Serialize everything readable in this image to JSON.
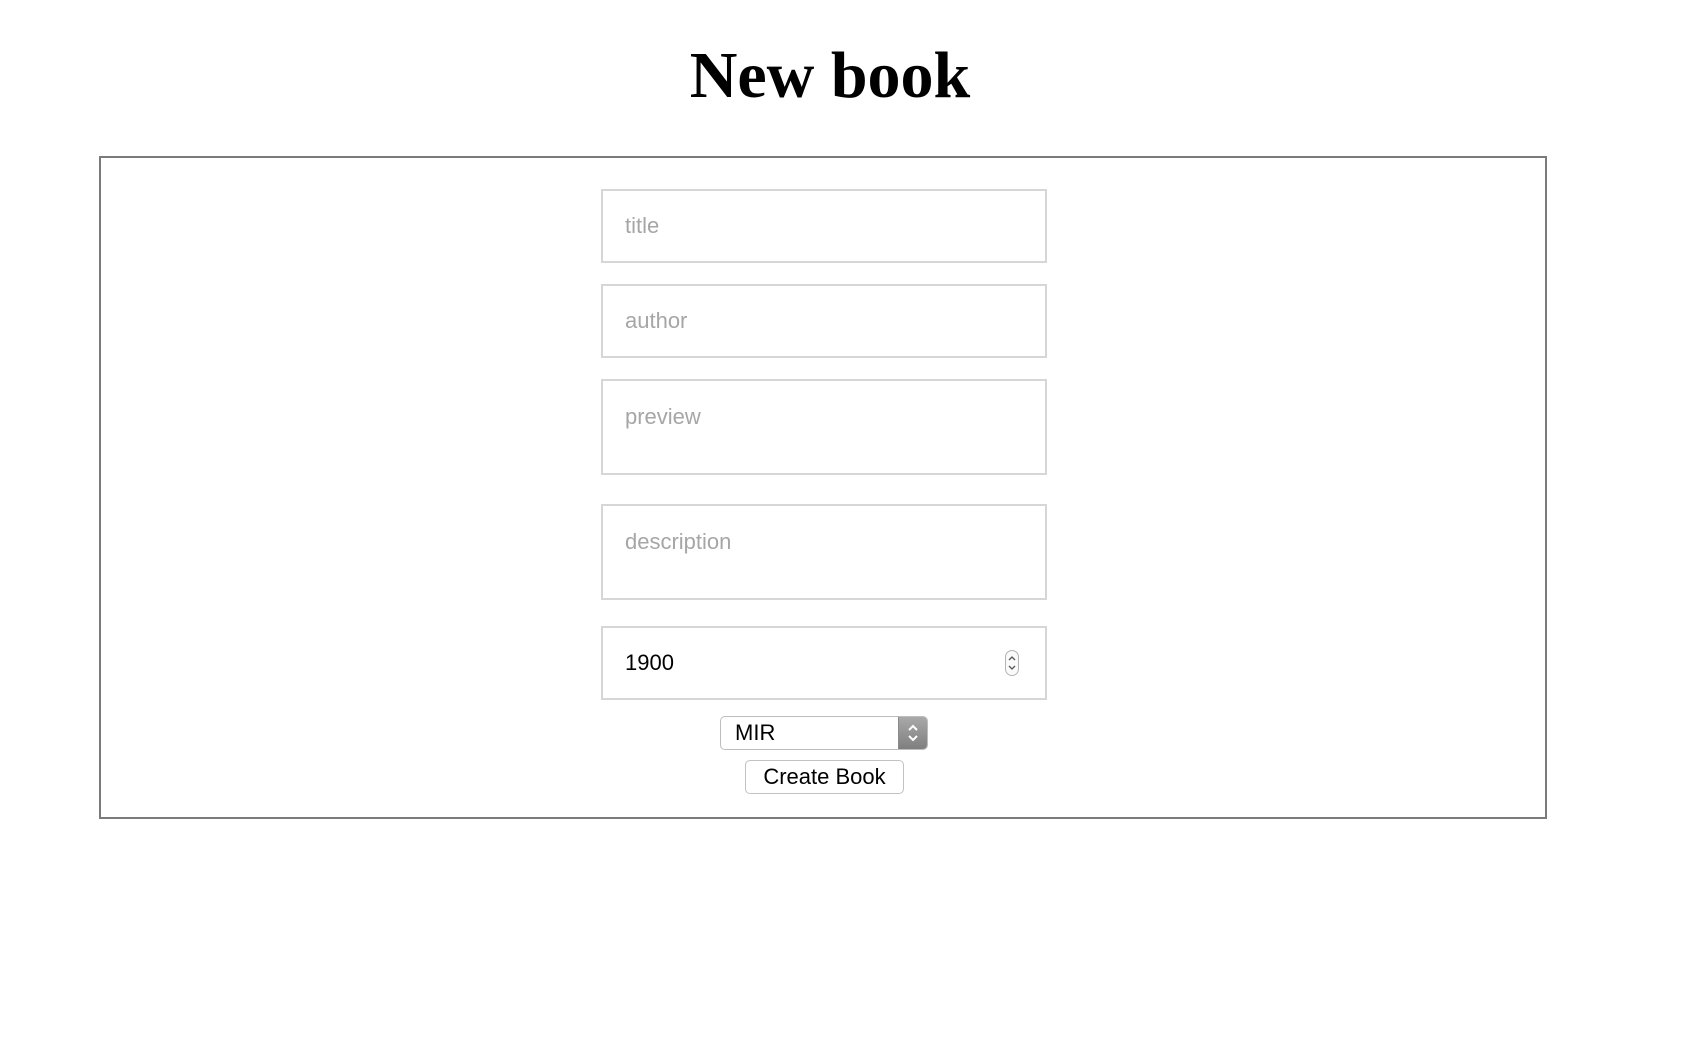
{
  "page": {
    "title": "New book"
  },
  "form": {
    "title_placeholder": "title",
    "author_placeholder": "author",
    "preview_placeholder": "preview",
    "description_placeholder": "description",
    "year_value": "1900",
    "publisher_selected": "MIR",
    "submit_label": "Create Book"
  },
  "icons": {
    "stepper": "number-stepper-icon",
    "select": "select-chevrons-icon"
  },
  "colors": {
    "border": "#7b7b7b",
    "field_border": "#d6d6d6",
    "placeholder": "#a6a6a6"
  }
}
